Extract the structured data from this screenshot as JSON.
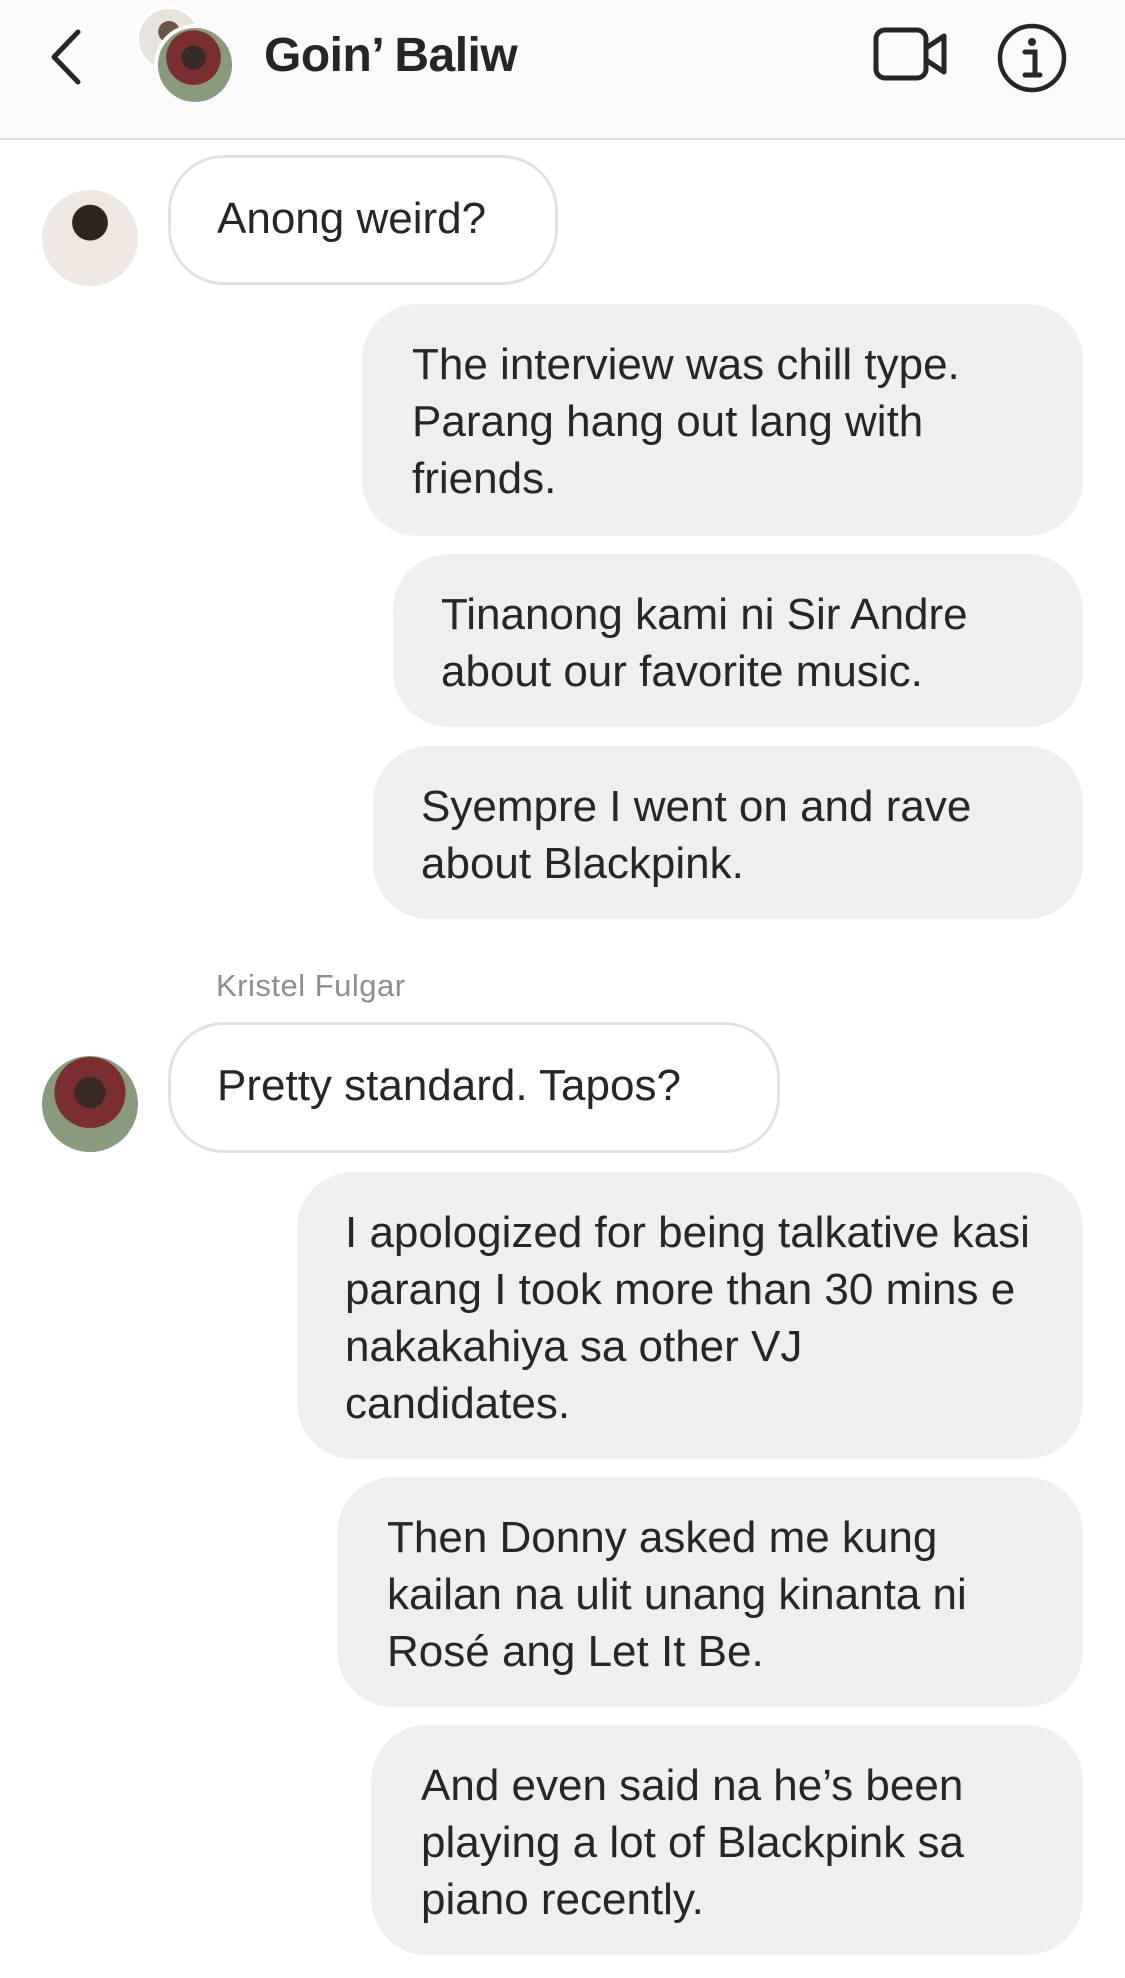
{
  "header": {
    "title": "Goin’ Baliw",
    "back_icon": "chevron-left-icon",
    "video_icon": "video-camera-icon",
    "info_icon": "info-circle-icon"
  },
  "messages": [
    {
      "direction": "incoming",
      "text": "Anong weird?"
    },
    {
      "direction": "outgoing",
      "text": "The interview was chill type. Parang hang out lang with friends."
    },
    {
      "direction": "outgoing",
      "text": "Tinanong kami ni Sir Andre about our favorite music."
    },
    {
      "direction": "outgoing",
      "text": "Syempre I went on and rave about Blackpink."
    },
    {
      "direction": "incoming",
      "sender": "Kristel Fulgar",
      "text": "Pretty standard. Tapos?"
    },
    {
      "direction": "outgoing",
      "text": "I apologized for being talkative kasi parang I took more than 30 mins e nakakahiya sa other VJ candidates."
    },
    {
      "direction": "outgoing",
      "text": "Then Donny asked me kung kailan na ulit unang kinanta ni Rosé ang Let It Be."
    },
    {
      "direction": "outgoing",
      "text": "And even said na he’s been playing a lot of Blackpink sa piano recently."
    }
  ],
  "colors": {
    "header_bg": "#fafafa",
    "outgoing_bubble": "#efefef",
    "incoming_border": "#e1e1e1",
    "text": "#262626",
    "muted": "#8e8e8e"
  }
}
